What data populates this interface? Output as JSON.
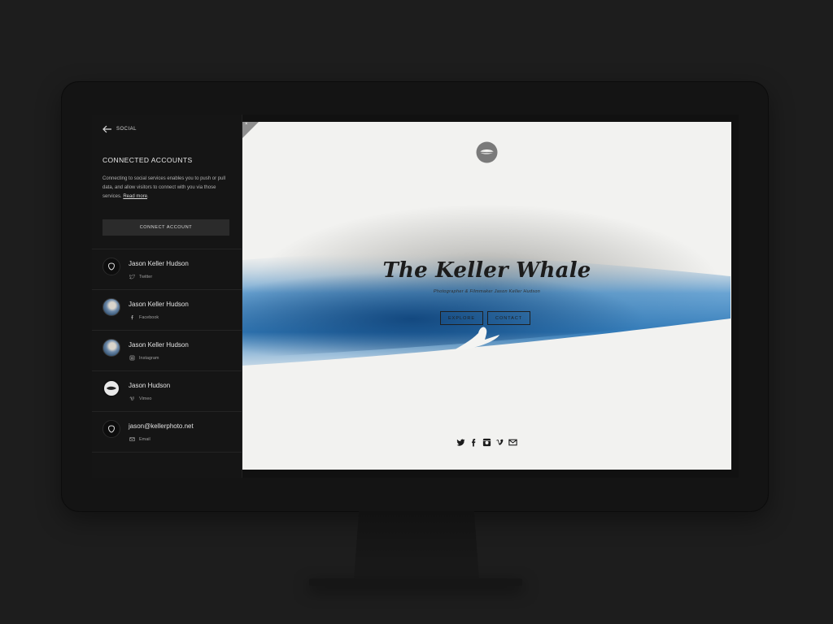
{
  "sidebar": {
    "back_label": "SOCIAL",
    "section_title": "CONNECTED ACCOUNTS",
    "description": "Connecting to social services enables you to push or pull data, and allow visitors to connect with you via those services.",
    "read_more": "Read more",
    "connect_button": "CONNECT ACCOUNT",
    "accounts": [
      {
        "name": "Jason Keller Hudson",
        "service": "Twitter",
        "service_icon": "twitter-icon"
      },
      {
        "name": "Jason Keller Hudson",
        "service": "Facebook",
        "service_icon": "facebook-icon"
      },
      {
        "name": "Jason Keller Hudson",
        "service": "Instagram",
        "service_icon": "instagram-icon"
      },
      {
        "name": "Jason Hudson",
        "service": "Vimeo",
        "service_icon": "vimeo-icon"
      },
      {
        "name": "jason@kellerphoto.net",
        "service": "Email",
        "service_icon": "email-icon"
      }
    ]
  },
  "preview": {
    "close_glyph": "×",
    "title": "The Keller Whale",
    "subtitle": "Photographer & Filmmaker Jason Keller Hudson",
    "buttons": {
      "explore": "EXPLORE",
      "contact": "CONTACT"
    },
    "social_icons": [
      "twitter-icon",
      "facebook-icon",
      "instagram-icon",
      "vimeo-icon",
      "email-icon"
    ]
  },
  "colors": {
    "background": "#1d1d1d",
    "sidebar": "#151515",
    "preview_bg": "#f2f2f0",
    "water_blue": "#2f7fc0",
    "text_dark": "#1c1c1c"
  }
}
